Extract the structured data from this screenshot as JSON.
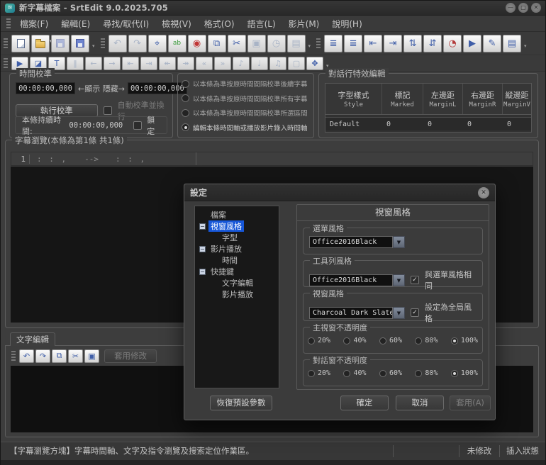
{
  "window": {
    "title": "新字幕檔案 - SrtEdit 9.0.2025.705"
  },
  "window_controls": [
    {
      "name": "minimize",
      "glyph": "—"
    },
    {
      "name": "maximize",
      "glyph": "▢"
    },
    {
      "name": "close",
      "glyph": "✕"
    }
  ],
  "menu": {
    "items": [
      "檔案(F)",
      "編輯(E)",
      "尋找/取代(I)",
      "檢視(V)",
      "格式(O)",
      "語言(L)",
      "影片(M)",
      "說明(H)"
    ]
  },
  "toolbar": {
    "row1_groups": [
      {
        "buttons": [
          {
            "name": "new-file",
            "kind": "page",
            "enabled": true
          },
          {
            "name": "open-file",
            "kind": "folder",
            "enabled": true,
            "dropdown": true
          },
          {
            "name": "save-file",
            "kind": "floppy",
            "enabled": false
          },
          {
            "name": "save-as",
            "kind": "floppy",
            "enabled": true
          }
        ]
      },
      {
        "buttons": [
          {
            "name": "undo",
            "glyph": "↶",
            "enabled": false
          },
          {
            "name": "redo",
            "glyph": "↷",
            "enabled": false
          },
          {
            "name": "find",
            "glyph": "⌖",
            "enabled": true
          },
          {
            "name": "replace",
            "glyph": "ab",
            "enabled": true,
            "color": "#3a9a3a"
          },
          {
            "name": "record-select",
            "glyph": "◉",
            "enabled": true,
            "color": "#c03535"
          },
          {
            "name": "copy",
            "glyph": "⧉",
            "enabled": true
          },
          {
            "name": "cut",
            "glyph": "✂",
            "enabled": true
          },
          {
            "name": "paste",
            "glyph": "▣",
            "enabled": false
          },
          {
            "name": "paste-time",
            "glyph": "◷",
            "enabled": false
          },
          {
            "name": "paste-special",
            "glyph": "▤",
            "enabled": false
          }
        ]
      },
      {
        "buttons": [
          {
            "name": "align-lines-top",
            "glyph": "≣",
            "enabled": true
          },
          {
            "name": "align-lines-bottom",
            "glyph": "≣",
            "enabled": true
          },
          {
            "name": "indent-left",
            "glyph": "⇤",
            "enabled": true
          },
          {
            "name": "indent-right",
            "glyph": "⇥",
            "enabled": true
          },
          {
            "name": "move-line-up",
            "glyph": "⇅",
            "enabled": true
          },
          {
            "name": "move-line-down",
            "glyph": "⇵",
            "enabled": true
          },
          {
            "name": "time-shift",
            "glyph": "◔",
            "enabled": true,
            "color": "#b33a3a"
          },
          {
            "name": "play-range",
            "glyph": "▶",
            "enabled": true
          },
          {
            "name": "edit-pen",
            "glyph": "✎",
            "enabled": true
          },
          {
            "name": "help-book",
            "glyph": "▤",
            "enabled": true
          }
        ]
      }
    ],
    "row2_buttons": [
      {
        "name": "play",
        "glyph": "▶",
        "enabled": true
      },
      {
        "name": "clapper",
        "glyph": "◪",
        "enabled": true
      },
      {
        "name": "text-mode",
        "glyph": "T",
        "enabled": true
      },
      {
        "name": "pause",
        "glyph": "‖",
        "enabled": false
      },
      {
        "name": "step-back",
        "glyph": "←",
        "enabled": false
      },
      {
        "name": "step-forward",
        "glyph": "→",
        "enabled": false
      },
      {
        "name": "go-first",
        "glyph": "⇤",
        "enabled": false
      },
      {
        "name": "go-last",
        "glyph": "⇥",
        "enabled": false
      },
      {
        "name": "prev-subtitle",
        "glyph": "↞",
        "enabled": false
      },
      {
        "name": "next-subtitle",
        "glyph": "↠",
        "enabled": false
      },
      {
        "name": "rewind",
        "glyph": "«",
        "enabled": false
      },
      {
        "name": "fast-forward",
        "glyph": "»",
        "enabled": false
      },
      {
        "name": "volume-up",
        "glyph": "♪",
        "enabled": false
      },
      {
        "name": "volume-down",
        "glyph": "♩",
        "enabled": false
      },
      {
        "name": "music-note",
        "glyph": "♫",
        "enabled": false
      },
      {
        "name": "video-window",
        "glyph": "▢",
        "enabled": false
      },
      {
        "name": "fullscreen",
        "glyph": "✥",
        "enabled": true
      }
    ]
  },
  "time_calibration": {
    "title": "時間校準",
    "show_time": "00:00:00,000",
    "hide_time": "00:00:00,000",
    "arrows_label": "←顯示 隱藏→",
    "execute_button": "執行校準",
    "auto_checkbox_label": "自動校準並換行",
    "duration_label": "本條持續時間:",
    "duration_value": "00:00:00,000",
    "lock_label": "鎖定"
  },
  "calibration_modes": {
    "options": [
      {
        "label": "以本條為準按原時間間隔校準後續字幕",
        "selected": false
      },
      {
        "label": "以本條為準按原時間間隔校準所有字幕",
        "selected": false
      },
      {
        "label": "以本條為準按原時間間隔校準所選區間",
        "selected": false
      },
      {
        "label": "編輯本條時間軸或播放影片錄入時間軸",
        "selected": true
      }
    ]
  },
  "dialog_effects": {
    "title": "對話行特效編輯",
    "columns": [
      {
        "zh": "字型樣式",
        "en": "Style"
      },
      {
        "zh": "標記",
        "en": "Marked"
      },
      {
        "zh": "左邊距",
        "en": "MarginL"
      },
      {
        "zh": "右邊距",
        "en": "MarginR"
      },
      {
        "zh": "縱邊距",
        "en": "MarginV"
      }
    ],
    "row": [
      "Default",
      "0",
      "0",
      "0",
      "0"
    ]
  },
  "subtitle_browser": {
    "title": "字幕瀏覽(本條為第1條 共1條)",
    "row": {
      "index": "1",
      "start": ":  :  ,",
      "arrow": "-->",
      "end": ":  :  ,"
    }
  },
  "text_editor": {
    "tab": "文字編輯",
    "buttons": [
      {
        "name": "undo",
        "glyph": "↶"
      },
      {
        "name": "redo",
        "glyph": "↷"
      },
      {
        "name": "copy",
        "glyph": "⧉"
      },
      {
        "name": "cut",
        "glyph": "✂"
      },
      {
        "name": "paste",
        "glyph": "▣"
      }
    ],
    "apply_button": "套用修改"
  },
  "status_bar": {
    "message": "【字幕瀏覽方塊】字幕時間軸、文字及指令瀏覽及搜索定位作業區。",
    "modified": "未修改",
    "insert_mode": "插入狀態"
  },
  "settings_dialog": {
    "title": "設定",
    "tree": [
      {
        "label": "檔案",
        "depth": 0,
        "box": false,
        "selected": false
      },
      {
        "label": "視窗風格",
        "depth": 0,
        "box": true,
        "selected": true
      },
      {
        "label": "字型",
        "depth": 1,
        "box": false,
        "selected": false
      },
      {
        "label": "影片播放",
        "depth": 0,
        "box": true,
        "selected": false
      },
      {
        "label": "時間",
        "depth": 1,
        "box": false,
        "selected": false
      },
      {
        "label": "快捷鍵",
        "depth": 0,
        "box": true,
        "selected": false
      },
      {
        "label": "文字編輯",
        "depth": 1,
        "box": false,
        "selected": false
      },
      {
        "label": "影片播放",
        "depth": 1,
        "box": false,
        "selected": false
      }
    ],
    "panel": {
      "header": "視窗風格",
      "menu_style": {
        "title": "選單風格",
        "value": "Office2016Black"
      },
      "toolbar_style": {
        "title": "工具列風格",
        "value": "Office2016Black",
        "checkbox": "與選單風格相同",
        "checked": true
      },
      "window_style": {
        "title": "視窗風格",
        "value": "Charcoal Dark Slate",
        "checkbox": "設定為全局風格",
        "checked": true
      },
      "main_opacity": {
        "title": "主視窗不透明度",
        "options": [
          "20%",
          "40%",
          "60%",
          "80%",
          "100%"
        ],
        "selected": "100%"
      },
      "dialog_opacity": {
        "title": "對話窗不透明度",
        "options": [
          "20%",
          "40%",
          "60%",
          "80%",
          "100%"
        ],
        "selected": "100%"
      }
    },
    "buttons": {
      "restore": "恢復預設參數",
      "ok": "確定",
      "cancel": "取消",
      "apply": "套用(A)"
    }
  },
  "colors": {
    "selection_blue": "#1757d8",
    "button_face": "#d9d9d9",
    "panel_bg": "#3d3d3d"
  }
}
